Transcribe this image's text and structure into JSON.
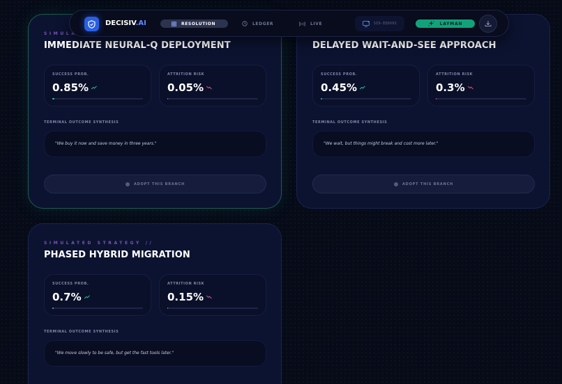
{
  "header": {
    "brand_main": "DECISIV",
    "brand_accent": ".AI",
    "tabs": [
      {
        "label": "RESOLUTION",
        "active": true,
        "icon": "grid-icon"
      },
      {
        "label": "LEDGER",
        "active": false,
        "icon": "clock-icon"
      },
      {
        "label": "LIVE",
        "active": false,
        "icon": "broadcast-icon"
      }
    ],
    "session_id": "SID-EQ0X01",
    "mode_label": "LAYMAN",
    "colors": {
      "accent": "#2a5fe4",
      "mode": "#12a27b"
    }
  },
  "strategies": [
    {
      "kicker": "SIMULAT",
      "title": "IMMEDIATE NEURAL-Q DEPLOYMENT",
      "success_label": "SUCCESS PROB.",
      "success_value": "0.85%",
      "success_level": 0.02,
      "risk_label": "ATTRITION RISK",
      "risk_value": "0.05%",
      "risk_level": 0.01,
      "synthesis_label": "TERMINAL OUTCOME SYNTHESIS",
      "quote": "\"We buy it now and save money in three years.\"",
      "adopt_label": "ADOPT THIS BRANCH"
    },
    {
      "kicker": "",
      "title": "DELAYED WAIT-AND-SEE APPROACH",
      "success_label": "SUCCESS PROB.",
      "success_value": "0.45%",
      "success_level": 0.012,
      "risk_label": "ATTRITION RISK",
      "risk_value": "0.3%",
      "risk_level": 0.01,
      "synthesis_label": "TERMINAL OUTCOME SYNTHESIS",
      "quote": "\"We wait, but things might break and cost more later.\"",
      "adopt_label": "ADOPT THIS BRANCH"
    },
    {
      "kicker": "SIMULATED STRATEGY //",
      "title": "PHASED HYBRID MIGRATION",
      "success_label": "SUCCESS PROB.",
      "success_value": "0.7%",
      "success_level": 0.015,
      "risk_label": "ATTRITION RISK",
      "risk_value": "0.15%",
      "risk_level": 0.01,
      "synthesis_label": "TERMINAL OUTCOME SYNTHESIS",
      "quote": "\"We move slowly to be safe, but get the fast tools later.\"",
      "adopt_label": ""
    }
  ],
  "colors": {
    "success": "#2fc59a",
    "risk": "#e0507a"
  }
}
